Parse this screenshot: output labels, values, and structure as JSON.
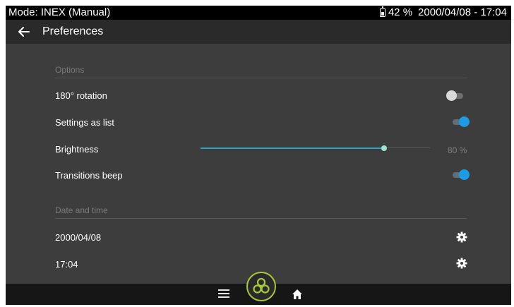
{
  "status_bar": {
    "mode": "Mode: INEX (Manual)",
    "battery": "42 %",
    "datetime": "2000/04/08 - 17:04"
  },
  "app_bar": {
    "title": "Preferences"
  },
  "options": {
    "header": "Options",
    "rotation": {
      "label": "180° rotation",
      "enabled": false
    },
    "settings_as_list": {
      "label": "Settings as list",
      "enabled": true
    },
    "brightness": {
      "label": "Brightness",
      "value_text": "80 %",
      "value": 0.8
    },
    "transitions_beep": {
      "label": "Transitions beep",
      "enabled": true
    }
  },
  "date_time": {
    "header": "Date and time",
    "date": "2000/04/08",
    "time": "17:04"
  },
  "icons": {
    "back": "arrow-left-icon",
    "battery": "battery-icon",
    "gear": "gear-icon",
    "menu": "menu-icon",
    "fan": "fan-icon",
    "home": "home-icon"
  },
  "colors": {
    "accent": "#1e9be5",
    "slider": "#2aa6c4",
    "fan_ring": "#a8c83a",
    "background": "#3d3d3d"
  }
}
